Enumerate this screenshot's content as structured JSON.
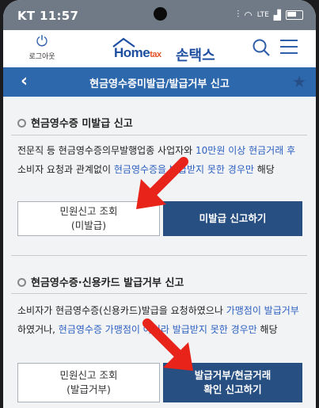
{
  "status": {
    "carrier": "KT",
    "time": "11:57",
    "network": "LTE"
  },
  "header": {
    "logout_label": "로그아웃",
    "logo_text_home": "Home",
    "logo_text_tax": "tax",
    "logo_text_kor": "손택스"
  },
  "titlebar": {
    "title": "현금영수증미발급/발급거부 신고"
  },
  "section1": {
    "heading": "현금영수증 미발급 신고",
    "line1_a": "전문직 등 현금영수증의무발행업종 사업자와 ",
    "line1_hl": "10만원 이상 현금거래 후",
    "line2_a": "소비자 요청과 관계없이 ",
    "line2_hl": "현금영수증을 발급받지 못한 경우만",
    "line2_b": " 해당",
    "btn_inquiry_1": "민원신고 조회",
    "btn_inquiry_2": "(미발급)",
    "btn_report": "미발급 신고하기"
  },
  "section2": {
    "heading": "현금영수증·신용카드 발급거부 신고",
    "line1_a": "소비자가 현금영수증(신용카드)발급을 요청하였으나 ",
    "line1_hl": "가맹점이 발급거부",
    "line2_a": "하였거나, ",
    "line2_hl": "현금영수증 가맹점이 아니라 발급받지 못한 경우만",
    "line2_b": " 해당",
    "btn_inquiry_1": "민원신고 조회",
    "btn_inquiry_2": "(발급거부)",
    "btn_report_1": "발급거부/현금거래",
    "btn_report_2": "확인 신고하기"
  },
  "colors": {
    "primary": "#2d68ad",
    "button": "#284f82",
    "highlight": "#2b5fc0",
    "arrow": "#e8231a"
  }
}
